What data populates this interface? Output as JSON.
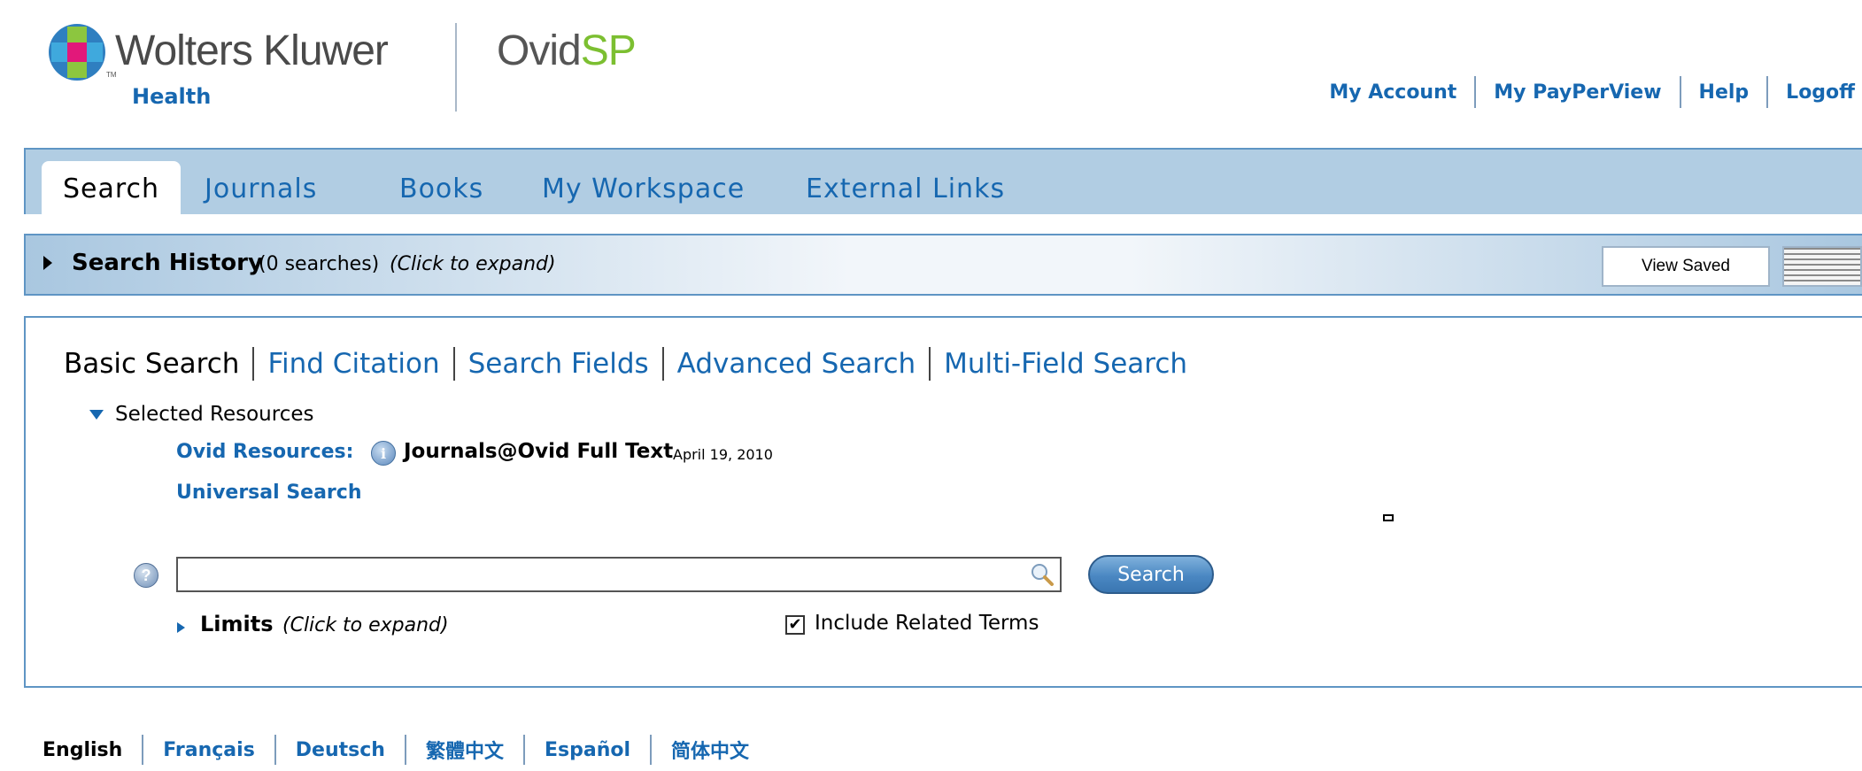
{
  "header": {
    "brand_name": "Wolters Kluwer",
    "brand_tm": "TM",
    "brand_sub": "Health",
    "product_name_part1": "Ovid",
    "product_name_part2": "SP",
    "product_colors": {
      "ovid": "#555555",
      "sp": "#7cbf31"
    },
    "top_links": [
      "My Account",
      "My PayPerView",
      "Help",
      "Logoff"
    ]
  },
  "nav": {
    "tabs": [
      {
        "label": "Search",
        "active": true
      },
      {
        "label": "Journals",
        "active": false
      },
      {
        "label": "Books",
        "active": false
      },
      {
        "label": "My Workspace",
        "active": false
      },
      {
        "label": "External Links",
        "active": false
      }
    ]
  },
  "search_history": {
    "title": "Search History",
    "count_text": "(0 searches)",
    "hint": "(Click to expand)",
    "view_saved_label": "View Saved",
    "expanded": false
  },
  "search_panel": {
    "modes": [
      {
        "label": "Basic Search",
        "active": true
      },
      {
        "label": "Find Citation",
        "active": false
      },
      {
        "label": "Search Fields",
        "active": false
      },
      {
        "label": "Advanced Search",
        "active": false
      },
      {
        "label": "Multi-Field Search",
        "active": false
      }
    ],
    "selected_resources_label": "Selected Resources",
    "ovid_resources_label": "Ovid Resources:",
    "info_icon_glyph": "i",
    "resource_name": "Journals@Ovid Full Text",
    "resource_date": "April 19, 2010",
    "universal_search_label": "Universal Search",
    "help_icon_glyph": "?",
    "search_input": {
      "value": "",
      "placeholder": ""
    },
    "search_button_label": "Search",
    "limits_label": "Limits",
    "limits_hint": "(Click to expand)",
    "include_related_terms_label": "Include Related Terms",
    "include_related_terms_checked": true,
    "checkbox_glyph": "✔"
  },
  "languages": [
    {
      "label": "English",
      "active": true
    },
    {
      "label": "Français",
      "active": false
    },
    {
      "label": "Deutsch",
      "active": false
    },
    {
      "label": "繁體中文",
      "active": false
    },
    {
      "label": "Español",
      "active": false
    },
    {
      "label": "简体中文",
      "active": false
    }
  ],
  "colors": {
    "link_blue": "#1667b0",
    "nav_bg": "#b1cde3",
    "border_blue": "#5f95c4",
    "button_blue": "#4a87c2"
  }
}
